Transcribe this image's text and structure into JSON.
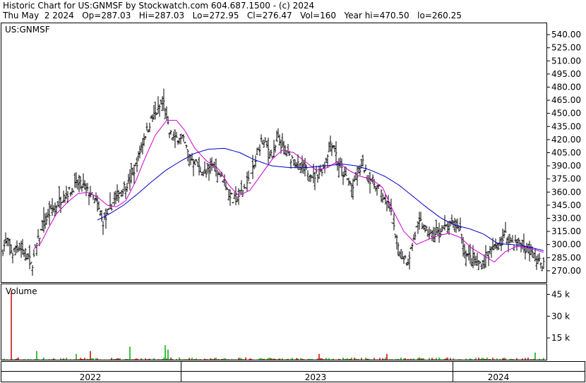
{
  "header": {
    "line1": "Historic Chart for US:GNMSF by Stockwatch.com 604.687.1500 - (c) 2024",
    "line2": "Thu May  2 2024   Op=287.03   Hi=287.03   Lo=272.95   Cl=276.47   Vol=160   Year hi=470.50   lo=260.25"
  },
  "price_panel": {
    "symbol_label": "US:GNMSF"
  },
  "volume_panel": {
    "label": "Volume"
  },
  "colors": {
    "bar_up": "#000000",
    "bar_down": "#000000",
    "ma_short": "#cc00cc",
    "ma_long": "#0000cc",
    "volume_up": "#00aa00",
    "volume_down": "#cc0000",
    "frame": "#000000"
  },
  "chart_data": [
    {
      "type": "ohlc",
      "series": [
        {
          "name": "price",
          "values": []
        },
        {
          "name": "short moving average",
          "values": []
        },
        {
          "name": "long moving average",
          "values": []
        }
      ],
      "y_ticks": [
        540,
        525,
        510,
        495,
        480,
        465,
        450,
        435,
        420,
        405,
        390,
        375,
        360,
        345,
        330,
        315,
        300,
        285,
        270
      ],
      "y_tick_labels": [
        "540.00",
        "525.00",
        "510.00",
        "495.00",
        "480.00",
        "465.00",
        "450.00",
        "435.00",
        "420.00",
        "405.00",
        "390.00",
        "375.00",
        "360.00",
        "345.00",
        "330.00",
        "315.00",
        "300.00",
        "285.00",
        "270.00"
      ],
      "ylim": [
        257,
        553
      ],
      "x_labels": [
        "2022",
        "2023",
        "2024"
      ],
      "keyframes": [
        [
          0,
          335
        ],
        [
          4,
          295
        ],
        [
          10,
          305
        ],
        [
          18,
          290
        ],
        [
          24,
          300
        ],
        [
          30,
          295
        ],
        [
          38,
          290
        ],
        [
          45,
          275
        ],
        [
          52,
          300
        ],
        [
          60,
          320
        ],
        [
          70,
          335
        ],
        [
          80,
          345
        ],
        [
          90,
          355
        ],
        [
          100,
          362
        ],
        [
          110,
          370
        ],
        [
          120,
          365
        ],
        [
          130,
          355
        ],
        [
          138,
          345
        ],
        [
          145,
          325
        ],
        [
          152,
          332
        ],
        [
          158,
          345
        ],
        [
          165,
          355
        ],
        [
          172,
          362
        ],
        [
          180,
          370
        ],
        [
          188,
          380
        ],
        [
          196,
          400
        ],
        [
          203,
          420
        ],
        [
          210,
          435
        ],
        [
          216,
          445
        ],
        [
          222,
          452
        ],
        [
          228,
          460
        ],
        [
          232,
          462
        ],
        [
          236,
          442
        ],
        [
          240,
          428
        ],
        [
          248,
          420
        ],
        [
          256,
          425
        ],
        [
          262,
          415
        ],
        [
          268,
          400
        ],
        [
          276,
          395
        ],
        [
          284,
          385
        ],
        [
          292,
          380
        ],
        [
          300,
          392
        ],
        [
          308,
          385
        ],
        [
          316,
          375
        ],
        [
          322,
          365
        ],
        [
          330,
          350
        ],
        [
          338,
          356
        ],
        [
          346,
          365
        ],
        [
          354,
          375
        ],
        [
          362,
          395
        ],
        [
          370,
          418
        ],
        [
          378,
          412
        ],
        [
          386,
          402
        ],
        [
          394,
          420
        ],
        [
          400,
          412
        ],
        [
          407,
          402
        ],
        [
          414,
          398
        ],
        [
          420,
          392
        ],
        [
          428,
          385
        ],
        [
          436,
          384
        ],
        [
          444,
          378
        ],
        [
          452,
          382
        ],
        [
          460,
          392
        ],
        [
          468,
          418
        ],
        [
          474,
          412
        ],
        [
          478,
          395
        ],
        [
          486,
          382
        ],
        [
          494,
          372
        ],
        [
          500,
          365
        ],
        [
          508,
          383
        ],
        [
          514,
          392
        ],
        [
          520,
          378
        ],
        [
          528,
          372
        ],
        [
          536,
          365
        ],
        [
          542,
          358
        ],
        [
          548,
          348
        ],
        [
          552,
          342
        ],
        [
          556,
          328
        ],
        [
          560,
          308
        ],
        [
          566,
          295
        ],
        [
          572,
          286
        ],
        [
          578,
          282
        ],
        [
          584,
          300
        ],
        [
          590,
          318
        ],
        [
          596,
          325
        ],
        [
          604,
          315
        ],
        [
          612,
          310
        ],
        [
          620,
          313
        ],
        [
          628,
          318
        ],
        [
          636,
          320
        ],
        [
          644,
          323
        ],
        [
          652,
          318
        ],
        [
          656,
          298
        ],
        [
          662,
          288
        ],
        [
          670,
          281
        ],
        [
          676,
          279
        ],
        [
          684,
          277
        ],
        [
          690,
          286
        ],
        [
          696,
          294
        ],
        [
          704,
          297
        ],
        [
          710,
          303
        ],
        [
          716,
          311
        ],
        [
          722,
          306
        ],
        [
          728,
          301
        ],
        [
          734,
          304
        ],
        [
          740,
          299
        ],
        [
          746,
          294
        ],
        [
          752,
          290
        ],
        [
          758,
          286
        ],
        [
          764,
          280
        ],
        [
          770,
          277
        ]
      ],
      "ma_short_keyframes": [
        [
          48,
          295
        ],
        [
          58,
          302
        ],
        [
          68,
          318
        ],
        [
          80,
          335
        ],
        [
          95,
          348
        ],
        [
          110,
          358
        ],
        [
          125,
          360
        ],
        [
          140,
          353
        ],
        [
          152,
          345
        ],
        [
          165,
          343
        ],
        [
          178,
          350
        ],
        [
          192,
          372
        ],
        [
          206,
          400
        ],
        [
          220,
          425
        ],
        [
          236,
          442
        ],
        [
          250,
          442
        ],
        [
          262,
          430
        ],
        [
          276,
          410
        ],
        [
          292,
          396
        ],
        [
          310,
          386
        ],
        [
          324,
          368
        ],
        [
          338,
          356
        ],
        [
          354,
          362
        ],
        [
          370,
          380
        ],
        [
          386,
          398
        ],
        [
          400,
          408
        ],
        [
          416,
          405
        ],
        [
          432,
          395
        ],
        [
          448,
          385
        ],
        [
          464,
          388
        ],
        [
          478,
          395
        ],
        [
          494,
          385
        ],
        [
          510,
          378
        ],
        [
          526,
          375
        ],
        [
          542,
          365
        ],
        [
          556,
          340
        ],
        [
          572,
          315
        ],
        [
          590,
          300
        ],
        [
          604,
          305
        ],
        [
          620,
          310
        ],
        [
          636,
          313
        ],
        [
          652,
          308
        ],
        [
          668,
          296
        ],
        [
          684,
          288
        ],
        [
          700,
          280
        ],
        [
          716,
          292
        ],
        [
          732,
          298
        ],
        [
          748,
          296
        ],
        [
          762,
          293
        ],
        [
          770,
          291
        ]
      ],
      "ma_long_keyframes": [
        [
          138,
          328
        ],
        [
          155,
          335
        ],
        [
          175,
          345
        ],
        [
          195,
          358
        ],
        [
          215,
          372
        ],
        [
          235,
          385
        ],
        [
          255,
          395
        ],
        [
          275,
          404
        ],
        [
          295,
          409
        ],
        [
          318,
          410
        ],
        [
          340,
          405
        ],
        [
          360,
          397
        ],
        [
          385,
          390
        ],
        [
          410,
          388
        ],
        [
          435,
          388
        ],
        [
          460,
          390
        ],
        [
          485,
          392
        ],
        [
          505,
          390
        ],
        [
          525,
          385
        ],
        [
          545,
          378
        ],
        [
          565,
          368
        ],
        [
          585,
          355
        ],
        [
          605,
          342
        ],
        [
          625,
          330
        ],
        [
          645,
          322
        ],
        [
          665,
          318
        ],
        [
          685,
          312
        ],
        [
          705,
          301
        ],
        [
          725,
          300
        ],
        [
          745,
          298
        ],
        [
          770,
          293
        ]
      ]
    },
    {
      "type": "bar",
      "series": [
        {
          "name": "Volume",
          "values": []
        }
      ],
      "y_ticks": [
        15,
        30,
        45
      ],
      "y_tick_labels": [
        "15 k",
        "30 k",
        "45 k"
      ],
      "ylim": [
        0,
        52
      ],
      "spikes": [
        [
          16,
          47,
          "down"
        ],
        [
          52,
          6,
          "up"
        ],
        [
          108,
          4,
          "up"
        ],
        [
          128,
          6,
          "down"
        ],
        [
          181,
          30,
          "up"
        ],
        [
          184,
          9,
          "up"
        ],
        [
          234,
          10,
          "up"
        ],
        [
          238,
          7,
          "up"
        ],
        [
          245,
          6,
          "up"
        ],
        [
          452,
          4,
          "down"
        ],
        [
          513,
          5,
          "up"
        ],
        [
          548,
          4,
          "down"
        ],
        [
          703,
          21,
          "down"
        ],
        [
          758,
          5,
          "up"
        ]
      ]
    }
  ]
}
